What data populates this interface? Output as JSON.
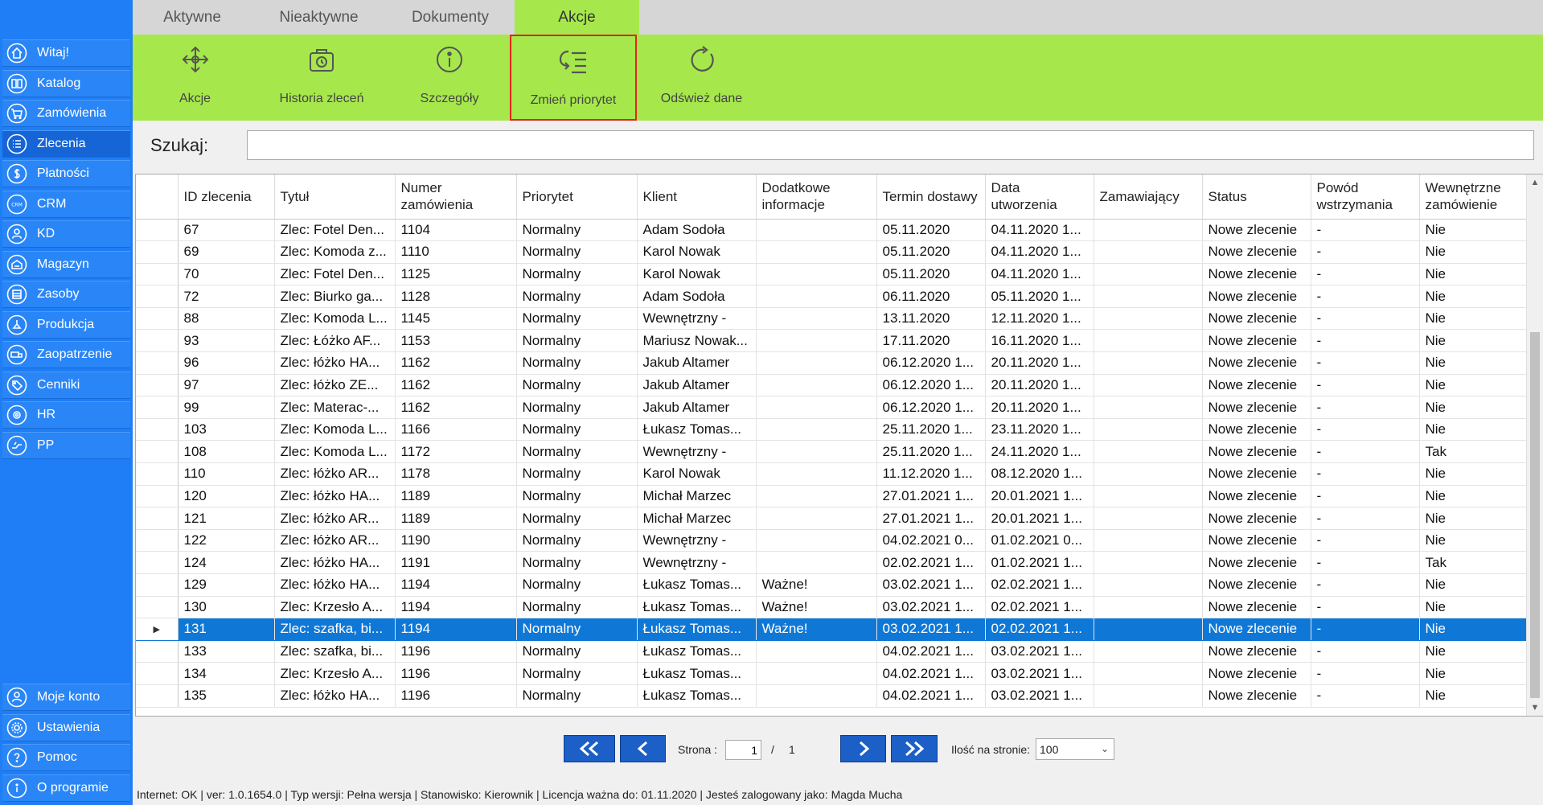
{
  "sidebar": {
    "items": [
      {
        "label": "Witaj!",
        "icon": "home-icon"
      },
      {
        "label": "Katalog",
        "icon": "book-icon"
      },
      {
        "label": "Zamówienia",
        "icon": "cart-icon"
      },
      {
        "label": "Zlecenia",
        "icon": "list-icon",
        "active": true
      },
      {
        "label": "Płatności",
        "icon": "dollar-icon"
      },
      {
        "label": "CRM",
        "icon": "crm-icon"
      },
      {
        "label": "KD",
        "icon": "person-icon"
      },
      {
        "label": "Magazyn",
        "icon": "warehouse-icon"
      },
      {
        "label": "Zasoby",
        "icon": "resources-icon"
      },
      {
        "label": "Produkcja",
        "icon": "production-icon"
      },
      {
        "label": "Zaopatrzenie",
        "icon": "truck-icon"
      },
      {
        "label": "Cenniki",
        "icon": "tag-icon"
      },
      {
        "label": "HR",
        "icon": "hr-icon"
      },
      {
        "label": "PP",
        "icon": "pp-icon"
      }
    ],
    "bottom_items": [
      {
        "label": "Moje konto",
        "icon": "account-icon"
      },
      {
        "label": "Ustawienia",
        "icon": "settings-icon"
      },
      {
        "label": "Pomoc",
        "icon": "help-icon"
      },
      {
        "label": "O programie",
        "icon": "info-icon"
      }
    ]
  },
  "tabs": [
    {
      "label": "Aktywne"
    },
    {
      "label": "Nieaktywne"
    },
    {
      "label": "Dokumenty"
    },
    {
      "label": "Akcje",
      "active": true
    }
  ],
  "ribbon": {
    "buttons": [
      {
        "label": "Akcje",
        "icon": "move-arrows-icon"
      },
      {
        "label": "Historia zleceń",
        "icon": "history-bag-icon"
      },
      {
        "label": "Szczegóły",
        "icon": "info-circle-icon"
      },
      {
        "label": "Zmień priorytet",
        "icon": "priority-list-icon",
        "highlighted": true
      },
      {
        "label": "Odśwież dane",
        "icon": "refresh-icon"
      }
    ]
  },
  "search": {
    "label": "Szukaj:",
    "value": ""
  },
  "table": {
    "columns": [
      "ID zlecenia",
      "Tytuł",
      "Numer zamówienia",
      "Priorytet",
      "Klient",
      "Dodatkowe informacje",
      "Termin dostawy",
      "Data utworzenia",
      "Zamawiający",
      "Status",
      "Powód wstrzymania",
      "Wewnętrzne zamówienie"
    ],
    "selected_row_marker": "▶",
    "rows": [
      [
        "67",
        "Zlec: Fotel Den...",
        "1104",
        "Normalny",
        "Adam Sodoła",
        "",
        "05.11.2020",
        "04.11.2020 1...",
        "",
        "Nowe zlecenie",
        "-",
        "Nie"
      ],
      [
        "69",
        "Zlec: Komoda z...",
        "1110",
        "Normalny",
        "Karol Nowak",
        "",
        "05.11.2020",
        "04.11.2020 1...",
        "",
        "Nowe zlecenie",
        "-",
        "Nie"
      ],
      [
        "70",
        "Zlec: Fotel Den...",
        "1125",
        "Normalny",
        "Karol Nowak",
        "",
        "05.11.2020",
        "04.11.2020 1...",
        "",
        "Nowe zlecenie",
        "-",
        "Nie"
      ],
      [
        "72",
        "Zlec: Biurko ga...",
        "1128",
        "Normalny",
        "Adam Sodoła",
        "",
        "06.11.2020",
        "05.11.2020 1...",
        "",
        "Nowe zlecenie",
        "-",
        "Nie"
      ],
      [
        "88",
        "Zlec: Komoda L...",
        "1145",
        "Normalny",
        "Wewnętrzny -",
        "",
        "13.11.2020",
        "12.11.2020 1...",
        "",
        "Nowe zlecenie",
        "-",
        "Nie"
      ],
      [
        "93",
        "Zlec: Łóżko AF...",
        "1153",
        "Normalny",
        "Mariusz Nowak...",
        "",
        "17.11.2020",
        "16.11.2020 1...",
        "",
        "Nowe zlecenie",
        "-",
        "Nie"
      ],
      [
        "96",
        "Zlec: łóżko HA...",
        "1162",
        "Normalny",
        "Jakub  Altamer",
        "",
        "06.12.2020 1...",
        "20.11.2020 1...",
        "",
        "Nowe zlecenie",
        "-",
        "Nie"
      ],
      [
        "97",
        "Zlec: łóżko ZE...",
        "1162",
        "Normalny",
        "Jakub  Altamer",
        "",
        "06.12.2020 1...",
        "20.11.2020 1...",
        "",
        "Nowe zlecenie",
        "-",
        "Nie"
      ],
      [
        "99",
        "Zlec: Materac-...",
        "1162",
        "Normalny",
        "Jakub  Altamer",
        "",
        "06.12.2020 1...",
        "20.11.2020 1...",
        "",
        "Nowe zlecenie",
        "-",
        "Nie"
      ],
      [
        "103",
        "Zlec: Komoda L...",
        "1166",
        "Normalny",
        "Łukasz Tomas...",
        "",
        "25.11.2020 1...",
        "23.11.2020 1...",
        "",
        "Nowe zlecenie",
        "-",
        "Nie"
      ],
      [
        "108",
        "Zlec: Komoda L...",
        "1172",
        "Normalny",
        "Wewnętrzny -",
        "",
        "25.11.2020 1...",
        "24.11.2020 1...",
        "",
        "Nowe zlecenie",
        "-",
        "Tak"
      ],
      [
        "110",
        "Zlec: łóżko AR...",
        "1178",
        "Normalny",
        "Karol Nowak",
        "",
        "11.12.2020 1...",
        "08.12.2020 1...",
        "",
        "Nowe zlecenie",
        "-",
        "Nie"
      ],
      [
        "120",
        "Zlec: łóżko HA...",
        "1189",
        "Normalny",
        "Michał Marzec",
        "",
        "27.01.2021 1...",
        "20.01.2021 1...",
        "",
        "Nowe zlecenie",
        "-",
        "Nie"
      ],
      [
        "121",
        "Zlec: łóżko AR...",
        "1189",
        "Normalny",
        "Michał Marzec",
        "",
        "27.01.2021 1...",
        "20.01.2021 1...",
        "",
        "Nowe zlecenie",
        "-",
        "Nie"
      ],
      [
        "122",
        "Zlec: łóżko AR...",
        "1190",
        "Normalny",
        "Wewnętrzny -",
        "",
        "04.02.2021 0...",
        "01.02.2021 0...",
        "",
        "Nowe zlecenie",
        "-",
        "Nie"
      ],
      [
        "124",
        "Zlec: łóżko HA...",
        "1191",
        "Normalny",
        "Wewnętrzny -",
        "",
        "02.02.2021 1...",
        "01.02.2021 1...",
        "",
        "Nowe zlecenie",
        "-",
        "Tak"
      ],
      [
        "129",
        "Zlec: łóżko HA...",
        "1194",
        "Normalny",
        "Łukasz Tomas...",
        "Ważne!",
        "03.02.2021 1...",
        "02.02.2021 1...",
        "",
        "Nowe zlecenie",
        "-",
        "Nie"
      ],
      [
        "130",
        "Zlec: Krzesło A...",
        "1194",
        "Normalny",
        "Łukasz Tomas...",
        "Ważne!",
        "03.02.2021 1...",
        "02.02.2021 1...",
        "",
        "Nowe zlecenie",
        "-",
        "Nie"
      ],
      [
        "131",
        "Zlec: szafka, bi...",
        "1194",
        "Normalny",
        "Łukasz Tomas...",
        "Ważne!",
        "03.02.2021 1...",
        "02.02.2021 1...",
        "",
        "Nowe zlecenie",
        "-",
        "Nie"
      ],
      [
        "133",
        "Zlec: szafka, bi...",
        "1196",
        "Normalny",
        "Łukasz Tomas...",
        "",
        "04.02.2021 1...",
        "03.02.2021 1...",
        "",
        "Nowe zlecenie",
        "-",
        "Nie"
      ],
      [
        "134",
        "Zlec: Krzesło A...",
        "1196",
        "Normalny",
        "Łukasz Tomas...",
        "",
        "04.02.2021 1...",
        "03.02.2021 1...",
        "",
        "Nowe zlecenie",
        "-",
        "Nie"
      ],
      [
        "135",
        "Zlec: łóżko HA...",
        "1196",
        "Normalny",
        "Łukasz Tomas...",
        "",
        "04.02.2021 1...",
        "03.02.2021 1...",
        "",
        "Nowe zlecenie",
        "-",
        "Nie"
      ]
    ],
    "selected_row": 18
  },
  "pager": {
    "page_label": "Strona :",
    "current_page": "1",
    "separator": "/",
    "total_pages": "1",
    "per_page_label": "Ilość na stronie:",
    "per_page_value": "100"
  },
  "statusbar": "Internet: OK  |   ver: 1.0.1654.0   |   Typ wersji: Pełna wersja   |   Stanowisko: Kierownik   |   Licencja ważna do: 01.11.2020  |   Jesteś zalogowany jako: Magda Mucha",
  "colors": {
    "sidebar": "#1f7ef5",
    "ribbon": "#a6e84b",
    "selection": "#0f78d7",
    "pager_button": "#1b5fc7",
    "highlight_border": "#e0251b"
  }
}
